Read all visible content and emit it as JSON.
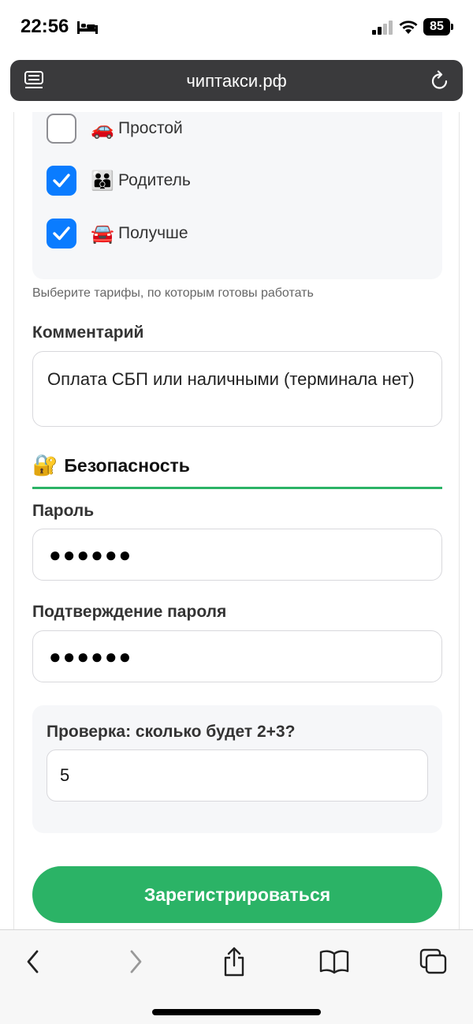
{
  "status_bar": {
    "time": "22:56",
    "battery": "85"
  },
  "browser": {
    "url": "чиптакси.рф"
  },
  "tariffs": [
    {
      "emoji": "🚗",
      "label": "Простой",
      "checked": false
    },
    {
      "emoji": "👪",
      "label": "Родитель",
      "checked": true
    },
    {
      "emoji": "🚘",
      "label": "Получше",
      "checked": true
    }
  ],
  "tariffs_hint": "Выберите тарифы, по которым готовы работать",
  "comment": {
    "label": "Комментарий",
    "value": "Оплата СБП или наличными (терминала нет)"
  },
  "security": {
    "emoji": "🔐",
    "title": "Безопасность"
  },
  "password": {
    "label": "Пароль",
    "masked": "●●●●●●"
  },
  "password_confirm": {
    "label": "Подтверждение пароля",
    "masked": "●●●●●●"
  },
  "captcha": {
    "label": "Проверка: сколько будет 2+3?",
    "value": "5"
  },
  "submit_label": "Зарегистрироваться",
  "colors": {
    "accent": "#2bb366",
    "checkbox": "#0a7cff"
  },
  "toolbar": [
    "back-icon",
    "forward-icon",
    "share-icon",
    "bookmarks-icon",
    "tabs-icon"
  ]
}
